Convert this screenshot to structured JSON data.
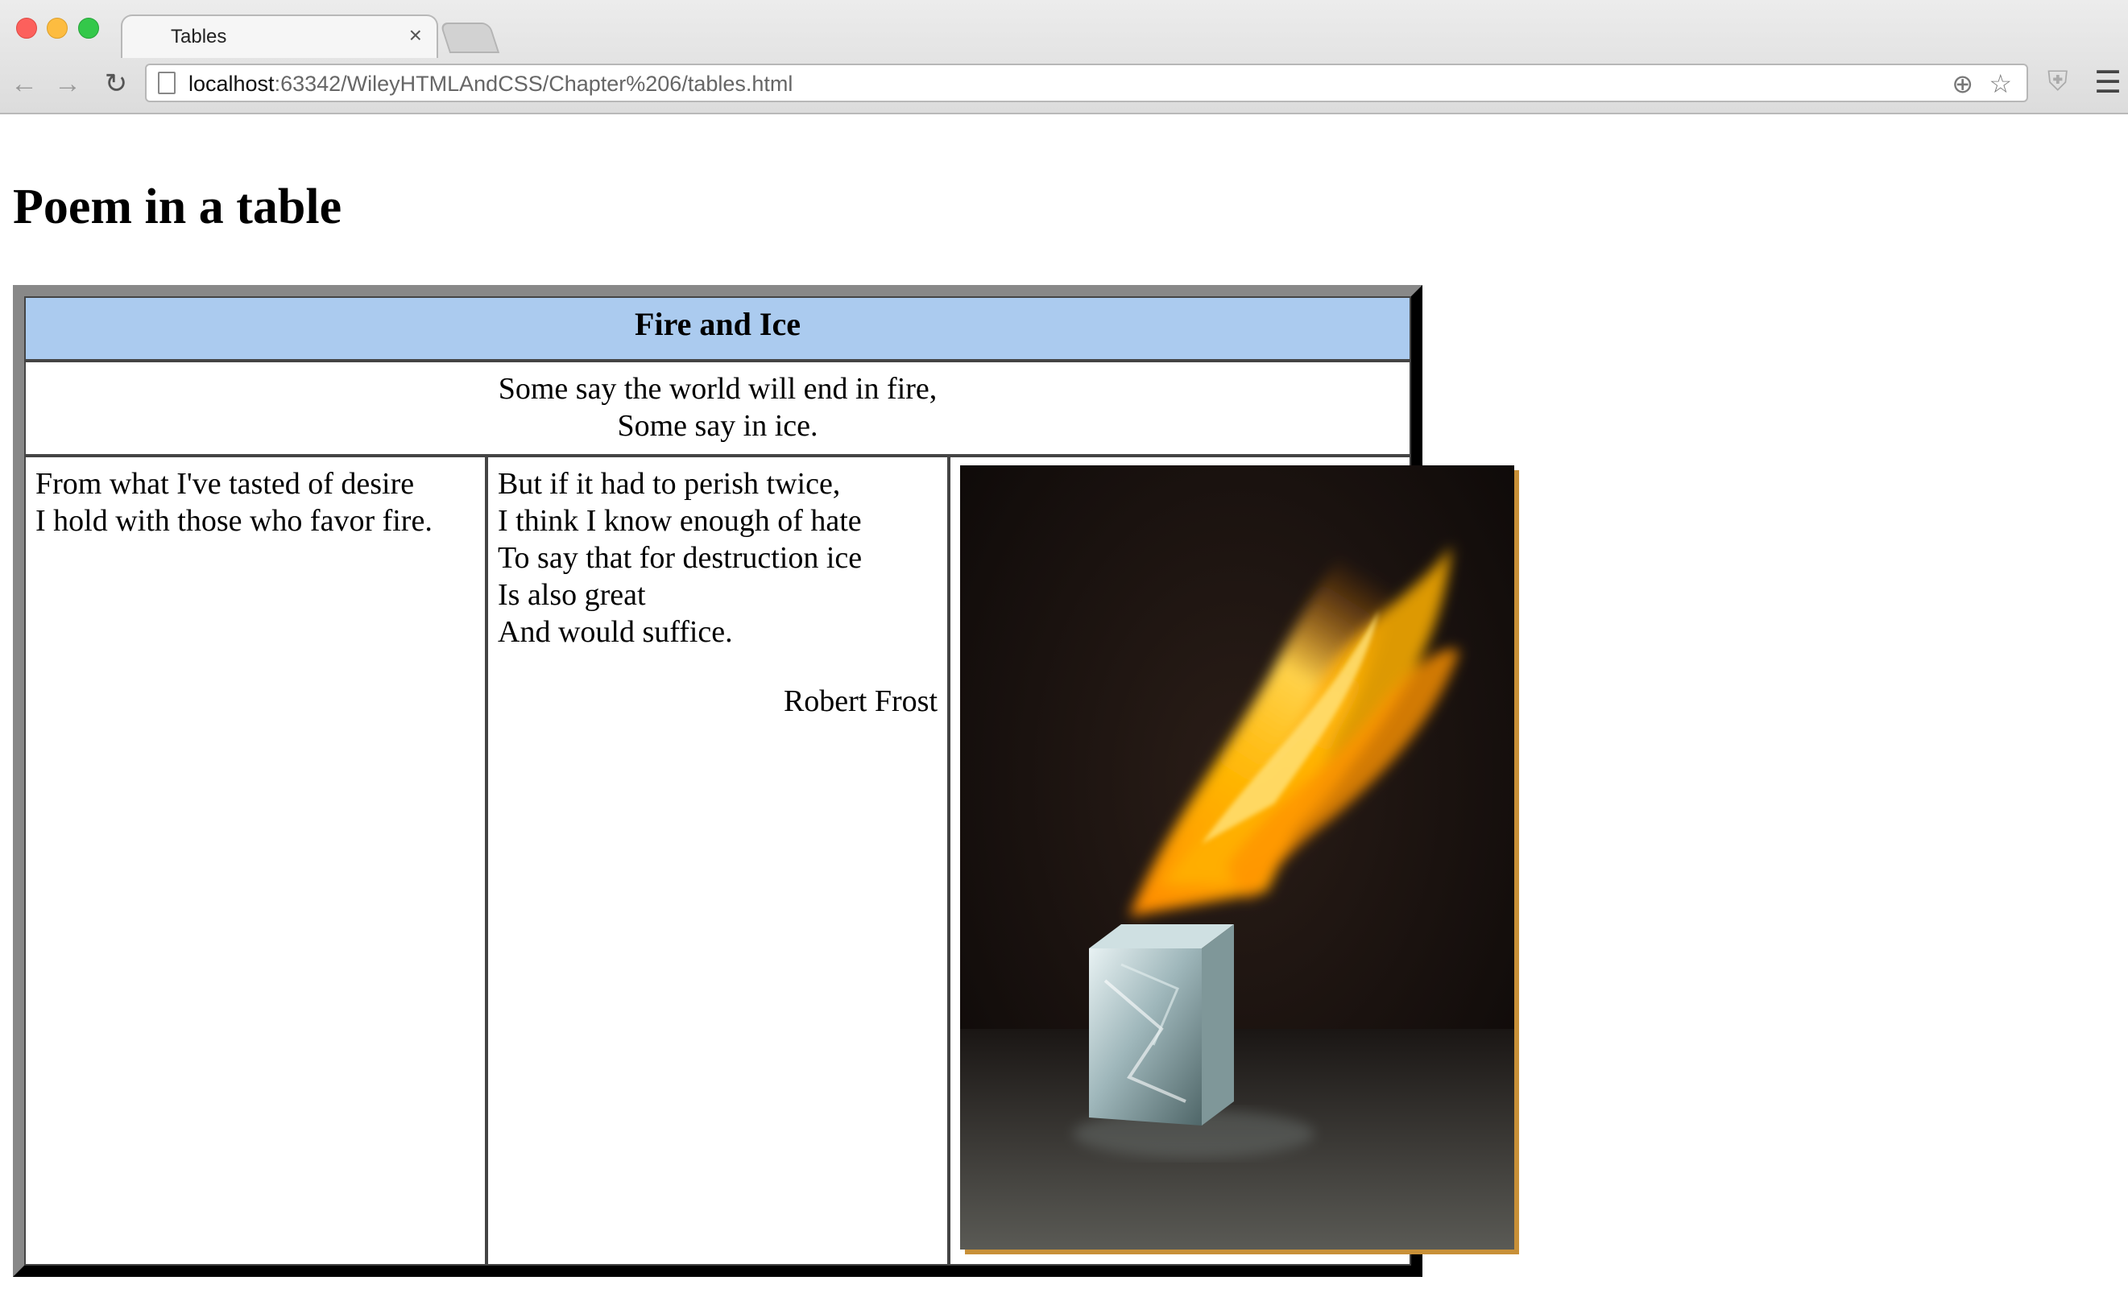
{
  "browser": {
    "tab_title": "Tables",
    "tab_close": "×",
    "url_host": "localhost",
    "url_rest": ":63342/WileyHTMLAndCSS/Chapter%206/tables.html",
    "icons": {
      "back": "back-arrow-icon",
      "forward": "forward-arrow-icon",
      "reload": "reload-icon",
      "zoom": "zoom-icon",
      "star": "star-icon",
      "extension": "shield-icon",
      "menu": "hamburger-menu-icon"
    }
  },
  "page": {
    "heading": "Poem in a table",
    "table": {
      "header": "Fire and Ice",
      "intro_lines": [
        "Some say the world will end in fire,",
        "Some say in ice."
      ],
      "col_a_lines": [
        "From what I've tasted of desire",
        "I hold with those who favor fire."
      ],
      "col_b_lines": [
        "But if it had to perish twice,",
        "I think I know enough of hate",
        "To say that for destruction ice",
        "Is also great",
        "And would suffice."
      ],
      "author": "Robert Frost",
      "image_subject": "flame-over-ice-cube"
    }
  },
  "colors": {
    "header_bg": "#abcbef",
    "table_border_light": "#888888",
    "table_border_dark": "#2b2b2b"
  }
}
